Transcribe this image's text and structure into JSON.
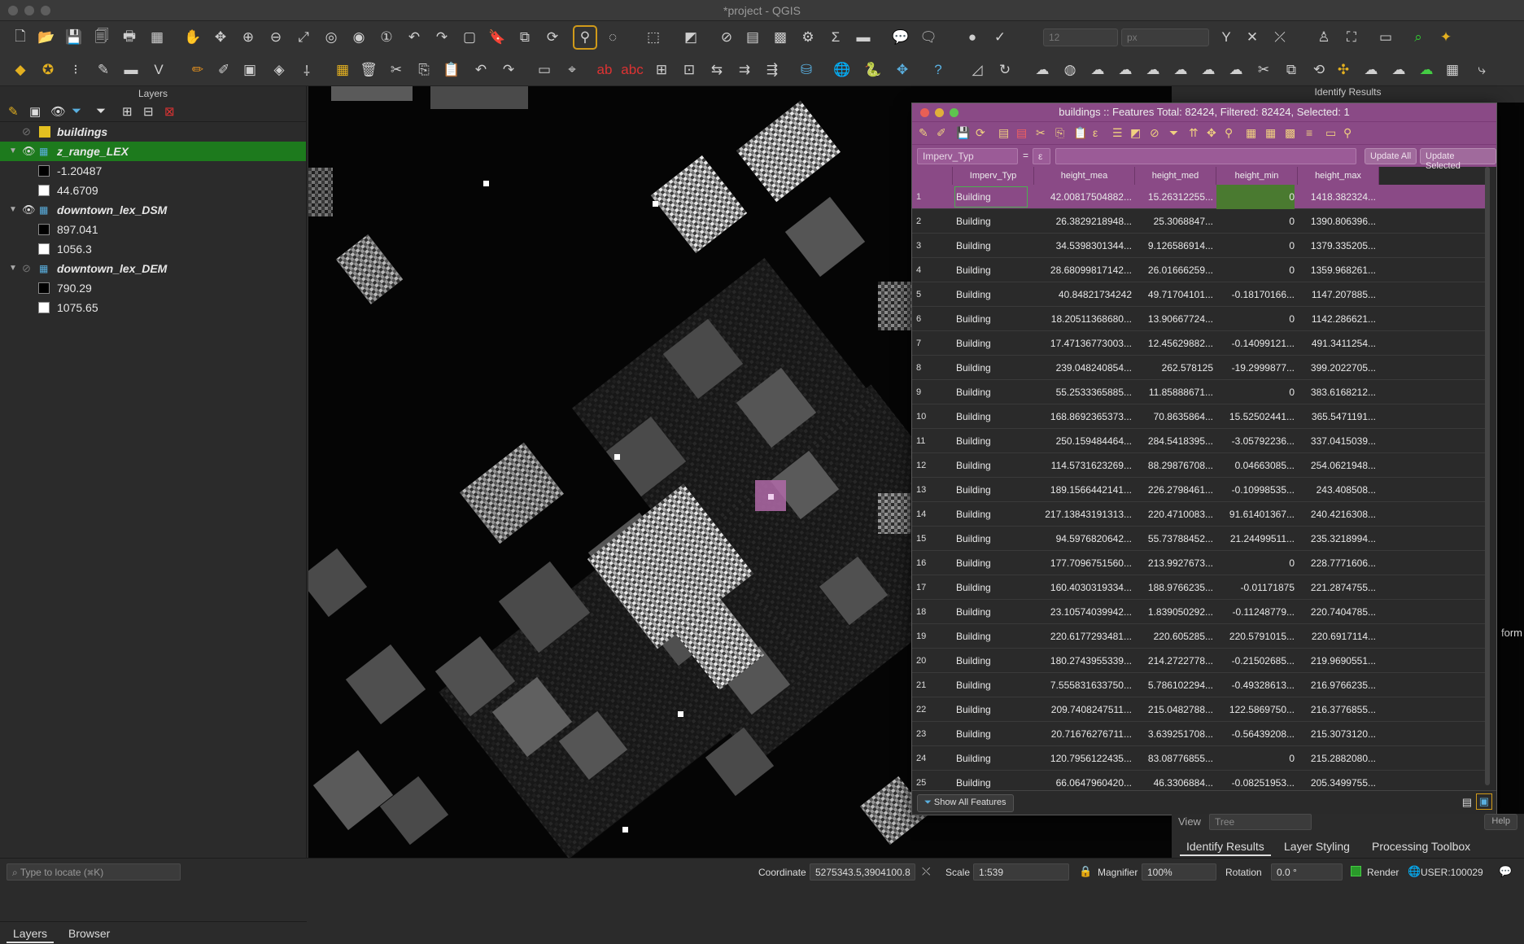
{
  "window": {
    "title": "*project - QGIS"
  },
  "toolbar": {
    "scale_value": "12",
    "unit_value": "px"
  },
  "layers_panel": {
    "title": "Layers",
    "items": [
      {
        "name": "buildings",
        "type": "vector",
        "visible": false,
        "selected": false
      },
      {
        "name": "z_range_LEX",
        "type": "raster",
        "visible": true,
        "selected": true,
        "legend": [
          {
            "color": "#000000",
            "label": "-1.20487"
          },
          {
            "color": "#ffffff",
            "label": "44.6709"
          }
        ]
      },
      {
        "name": "downtown_lex_DSM",
        "type": "raster",
        "visible": true,
        "selected": false,
        "legend": [
          {
            "color": "#000000",
            "label": "897.041"
          },
          {
            "color": "#ffffff",
            "label": "1056.3"
          }
        ]
      },
      {
        "name": "downtown_lex_DEM",
        "type": "raster",
        "visible": false,
        "selected": false,
        "legend": [
          {
            "color": "#000000",
            "label": "790.29"
          },
          {
            "color": "#ffffff",
            "label": "1075.65"
          }
        ]
      }
    ],
    "tabs": [
      "Layers",
      "Browser"
    ]
  },
  "locate_placeholder": "Type to locate (⌘K)",
  "attribute_table": {
    "title": "buildings :: Features Total: 82424, Filtered: 82424, Selected: 1",
    "filter_field": "Imperv_Typ",
    "filter_op": "=",
    "update_all": "Update All",
    "update_selected": "Update Selected",
    "columns": [
      "Imperv_Typ",
      "height_mea",
      "height_med",
      "height_min",
      "height_max"
    ],
    "rows": [
      [
        "1",
        "Building",
        "42.00817504882...",
        "15.26312255...",
        "0",
        "1418.382324..."
      ],
      [
        "2",
        "Building",
        "26.3829218948...",
        "25.3068847...",
        "0",
        "1390.806396..."
      ],
      [
        "3",
        "Building",
        "34.5398301344...",
        "9.126586914...",
        "0",
        "1379.335205..."
      ],
      [
        "4",
        "Building",
        "28.68099817142...",
        "26.01666259...",
        "0",
        "1359.968261..."
      ],
      [
        "5",
        "Building",
        "40.84821734242",
        "49.71704101...",
        "-0.18170166...",
        "1147.207885..."
      ],
      [
        "6",
        "Building",
        "18.20511368680...",
        "13.90667724...",
        "0",
        "1142.286621..."
      ],
      [
        "7",
        "Building",
        "17.47136773003...",
        "12.45629882...",
        "-0.14099121...",
        "491.3411254..."
      ],
      [
        "8",
        "Building",
        "239.048240854...",
        "262.578125",
        "-19.2999877...",
        "399.2022705..."
      ],
      [
        "9",
        "Building",
        "55.2533365885...",
        "11.85888671...",
        "0",
        "383.6168212..."
      ],
      [
        "10",
        "Building",
        "168.8692365373...",
        "70.8635864...",
        "15.52502441...",
        "365.5471191..."
      ],
      [
        "11",
        "Building",
        "250.159484464...",
        "284.5418395...",
        "-3.05792236...",
        "337.0415039..."
      ],
      [
        "12",
        "Building",
        "114.5731623269...",
        "88.29876708...",
        "0.04663085...",
        "254.0621948..."
      ],
      [
        "13",
        "Building",
        "189.1566442141...",
        "226.2798461...",
        "-0.10998535...",
        "243.408508..."
      ],
      [
        "14",
        "Building",
        "217.13843191313...",
        "220.4710083...",
        "91.61401367...",
        "240.4216308..."
      ],
      [
        "15",
        "Building",
        "94.5976820642...",
        "55.73788452...",
        "21.24499511...",
        "235.3218994..."
      ],
      [
        "16",
        "Building",
        "177.7096751560...",
        "213.9927673...",
        "0",
        "228.7771606..."
      ],
      [
        "17",
        "Building",
        "160.4030319334...",
        "188.9766235...",
        "-0.01171875",
        "221.2874755..."
      ],
      [
        "18",
        "Building",
        "23.10574039942...",
        "1.839050292...",
        "-0.11248779...",
        "220.7404785..."
      ],
      [
        "19",
        "Building",
        "220.6177293481...",
        "220.605285...",
        "220.5791015...",
        "220.6917114..."
      ],
      [
        "20",
        "Building",
        "180.2743955339...",
        "214.2722778...",
        "-0.21502685...",
        "219.9690551..."
      ],
      [
        "21",
        "Building",
        "7.555831633750...",
        "5.786102294...",
        "-0.49328613...",
        "216.9766235..."
      ],
      [
        "22",
        "Building",
        "209.7408247511...",
        "215.0482788...",
        "122.5869750...",
        "216.3776855..."
      ],
      [
        "23",
        "Building",
        "20.71676276711...",
        "3.639251708...",
        "-0.56439208...",
        "215.3073120..."
      ],
      [
        "24",
        "Building",
        "120.7956122435...",
        "83.08776855...",
        "0",
        "215.2882080..."
      ],
      [
        "25",
        "Building",
        "66.0647960420...",
        "46.3306884...",
        "-0.08251953...",
        "205.3499755..."
      ]
    ],
    "show_all_label": "Show All Features"
  },
  "identify": {
    "title": "Identify Results",
    "view_label": "View",
    "view_value": "Tree",
    "help_label": "Help",
    "form_label": "form",
    "tabs": [
      "Identify Results",
      "Layer Styling",
      "Processing Toolbox"
    ]
  },
  "statusbar": {
    "coordinate_label": "Coordinate",
    "coordinate_value": "5275343.5,3904100.8",
    "scale_label": "Scale",
    "scale_value": "1:539",
    "magnifier_label": "Magnifier",
    "magnifier_value": "100%",
    "rotation_label": "Rotation",
    "rotation_value": "0.0 °",
    "render_label": "Render",
    "crs_label": "USER:100029"
  },
  "colors": {
    "selection_purple": "#8a4a86",
    "layer_selected_green": "#1d7a1d",
    "active_tool_outline": "#d09a1a"
  }
}
